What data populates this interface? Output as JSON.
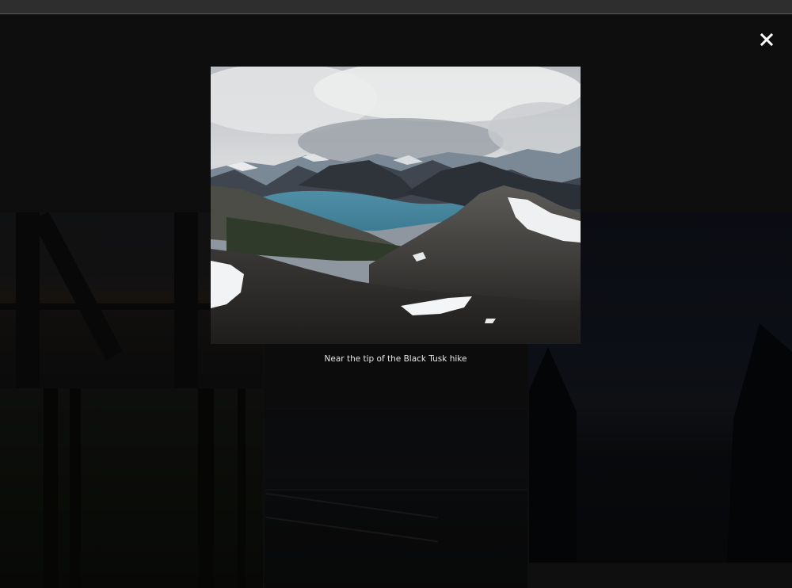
{
  "lightbox": {
    "caption": "Near the tip of the Black Tusk hike",
    "close_icon": "close-icon",
    "image_subject": "mountain-lake-photo"
  },
  "gallery": {
    "tiles": [
      {
        "name": "gallery-tile-sunset-structure"
      },
      {
        "name": "gallery-tile-forest"
      },
      {
        "name": "gallery-tile-dark-lake"
      },
      {
        "name": "gallery-tile-dock"
      },
      {
        "name": "gallery-tile-mountain-lake-night"
      },
      {
        "name": "gallery-tile-bottom"
      }
    ]
  },
  "colors": {
    "backdrop": "#171717",
    "caption_text": "#e6e6e6",
    "close_icon": "#ffffff"
  }
}
